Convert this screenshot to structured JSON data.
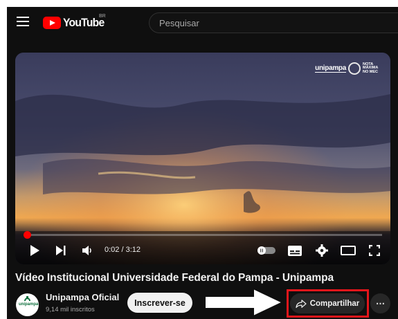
{
  "masthead": {
    "logo_text": "YouTube",
    "country_code": "BR",
    "search_placeholder": "Pesquisar"
  },
  "player": {
    "watermark_logo": "unipampa",
    "watermark_text": "NOTA MÁXIMA NO MEC",
    "current_time": "0:02",
    "duration": "3:12",
    "progress_fraction": 0.0104
  },
  "video": {
    "title": "Vídeo Institucional Universidade Federal do Pampa - Unipampa"
  },
  "channel": {
    "avatar_text": "unipampa",
    "name": "Unipampa Oficial",
    "subscribers": "9,14 mil inscritos",
    "subscribe_label": "Inscrever-se"
  },
  "actions": {
    "share_label": "Compartilhar",
    "more_label": "⋯"
  },
  "colors": {
    "background": "#0f0f0f",
    "brand_red": "#ff0000",
    "highlight_red": "#e3161b"
  }
}
